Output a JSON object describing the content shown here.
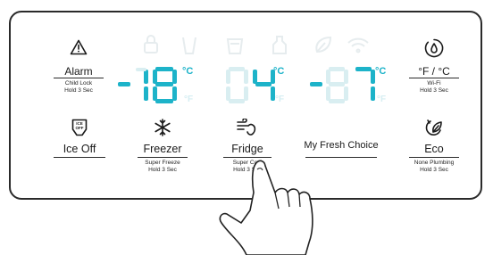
{
  "colors": {
    "display_active": "#1db3c9",
    "display_inactive": "#d9eef1",
    "border": "#2a2a2a"
  },
  "zones": [
    {
      "name": "freezer",
      "sign": "-",
      "digits": "18",
      "unit_c": "°C",
      "unit_f": "°F"
    },
    {
      "name": "fridge",
      "digits": "04",
      "unit_c": "°C",
      "unit_f": "°F"
    },
    {
      "name": "variable",
      "sign": "-",
      "digits": "?7",
      "unit_c": "°C",
      "unit_f": "°F"
    }
  ],
  "buttons": {
    "alarm": {
      "label": "Alarm",
      "sub1": "Child Lock",
      "sub2": "Hold 3 Sec",
      "icon": "alert-triangle-icon"
    },
    "temp_unit": {
      "label": "°F / °C",
      "sub1": "Wi-Fi",
      "sub2": "Hold 3 Sec",
      "icon": "water-drop-circle-icon"
    },
    "ice_off": {
      "label": "Ice Off",
      "icon": "ice-off-icon",
      "icon_text": "ICE OFF"
    },
    "freezer": {
      "label": "Freezer",
      "sub1": "Super Freeze",
      "sub2": "Hold 3 Sec",
      "icon": "snowflake-icon"
    },
    "fridge": {
      "label": "Fridge",
      "sub1": "Super Cool",
      "sub2": "Hold 3 Sec",
      "icon": "cool-wind-icon"
    },
    "my_fresh_choice": {
      "label": "My Fresh Choice"
    },
    "eco": {
      "label": "Eco",
      "sub1": "None Plumbing",
      "sub2": "Hold 3 Sec",
      "icon": "eco-leaf-icon"
    }
  },
  "status_icons": [
    "lock-icon",
    "glass-icon",
    "cup-icon",
    "bottle-icon",
    "leaf-icon",
    "wifi-icon"
  ]
}
